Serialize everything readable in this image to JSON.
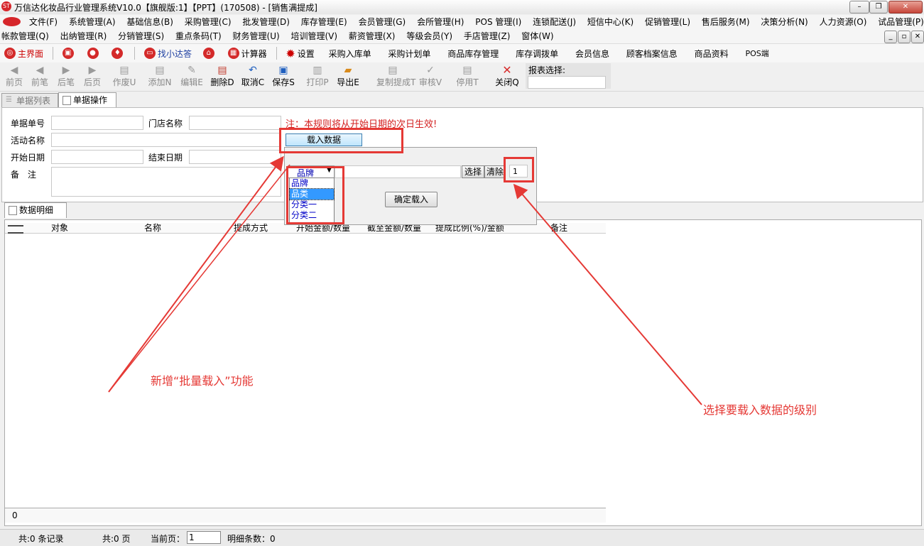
{
  "title_bar": {
    "app_logo_text": "ST",
    "title": "万信达化妆品行业管理系统V10.0【旗舰版:1】【PPT】(170508) - [销售满提成]",
    "minimize": "–",
    "restore": "❐",
    "close": "✕"
  },
  "menu": {
    "row1": [
      "文件(F)",
      "系统管理(A)",
      "基础信息(B)",
      "采购管理(C)",
      "批发管理(D)",
      "库存管理(E)",
      "会员管理(G)",
      "会所管理(H)",
      "POS 管理(I)",
      "连锁配送(J)",
      "短信中心(K)",
      "促销管理(L)",
      "售后服务(M)",
      "决策分析(N)",
      "人力资源(O)",
      "试品管理(P)"
    ],
    "row2": [
      "帐款管理(Q)",
      "出纳管理(R)",
      "分销管理(S)",
      "重点条码(T)",
      "财务管理(U)",
      "培训管理(V)",
      "薪资管理(X)",
      "等级会员(Y)",
      "手店管理(Z)",
      "窗体(W)"
    ],
    "mdi_min": "_",
    "mdi_restore": "▫",
    "mdi_close": "✕"
  },
  "quickbar": {
    "home": "主界面",
    "find": "找小达答",
    "calculator": "计算器",
    "settings": "设置",
    "links": [
      "采购入库单",
      "采购计划单",
      "商品库存管理",
      "库存调拨单",
      "会员信息",
      "顾客档案信息",
      "商品资料",
      "POS端"
    ]
  },
  "toolbar": {
    "first": "前页",
    "prev": "前笔",
    "next": "后笔",
    "last": "后页",
    "void": "作废U",
    "add": "添加N",
    "edit": "编辑E",
    "delete": "删除D",
    "cancel": "取消C",
    "save": "保存S",
    "print": "打印P",
    "export": "导出E",
    "copy": "复制提成T",
    "audit": "审核V",
    "disable": "停用T",
    "close": "关闭Q",
    "report_label": "报表选择:"
  },
  "tabs": {
    "list": "单据列表",
    "operation": "单据操作",
    "detail": "数据明细"
  },
  "form": {
    "doc_no_label": "单据单号",
    "store_label": "门店名称",
    "activity_label": "活动名称",
    "start_label": "开始日期",
    "end_label": "结束日期",
    "remark_label": "备　注",
    "notice": "注：本规则将从开始日期的次日生效!",
    "load_button": "载入数据"
  },
  "popup": {
    "selected_level": "品牌",
    "options": [
      "品牌",
      "品类",
      "分类一",
      "分类二"
    ],
    "select_button": "选择",
    "clear_button": "清除",
    "count_value": "1",
    "confirm_button": "确定载入"
  },
  "grid": {
    "columns": [
      "对象",
      "名称",
      "提成方式",
      "开始金额/数量",
      "截至金额/数量",
      "提成比例(%)/金额",
      "备注"
    ],
    "footer_value": "0"
  },
  "status": {
    "records": "共:0 条记录",
    "pages": "共:0 页",
    "current_page_label": "当前页：",
    "current_page": "1",
    "detail_count": "明细条数：0"
  },
  "annotations": {
    "batch_load": "新增“批量载入”功能",
    "choose_level": "选择要载入数据的级别"
  },
  "colors": {
    "annotation_red": "#e53935",
    "brand_red": "#d42a2a",
    "selection_blue": "#3399ff"
  }
}
